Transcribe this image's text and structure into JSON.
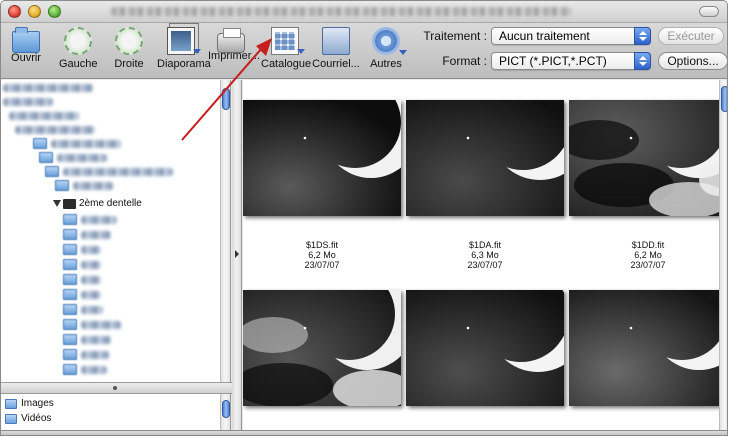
{
  "window": {
    "title": ""
  },
  "toolbar": {
    "tools": [
      {
        "id": "open",
        "label": "Ouvrir",
        "icon": "folder-icon"
      },
      {
        "id": "left",
        "label": "Gauche",
        "icon": "rotate-left-icon"
      },
      {
        "id": "right",
        "label": "Droite",
        "icon": "rotate-right-icon"
      },
      {
        "id": "slideshow",
        "label": "Diaporama",
        "icon": "slideshow-icon"
      },
      {
        "id": "print",
        "label": "Imprimer...",
        "icon": "printer-icon"
      },
      {
        "id": "catalog",
        "label": "Catalogue",
        "icon": "catalog-icon"
      },
      {
        "id": "mail",
        "label": "Courriel...",
        "icon": "mail-icon"
      },
      {
        "id": "more",
        "label": "Autres",
        "icon": "gear-icon"
      }
    ],
    "treatment": {
      "label": "Traitement :",
      "value": "Aucun traitement"
    },
    "format": {
      "label": "Format :",
      "value": "PICT (*.PICT,*.PCT)"
    },
    "execute_label": "Exécuter",
    "options_label": "Options..."
  },
  "tree": {
    "selected_folder": "2ème dentelle"
  },
  "places": [
    {
      "label": "Images",
      "icon": "folder-icon"
    },
    {
      "label": "Vidéos",
      "icon": "folder-icon"
    }
  ],
  "thumbnails": [
    {
      "name": "$1DS.fit",
      "size": "6,2 Mo",
      "date": "23/07/07"
    },
    {
      "name": "$1DA.fit",
      "size": "6,3 Mo",
      "date": "23/07/07"
    },
    {
      "name": "$1DD.fit",
      "size": "6,2 Mo",
      "date": "23/07/07"
    },
    {
      "name": "",
      "size": "",
      "date": ""
    },
    {
      "name": "",
      "size": "",
      "date": ""
    },
    {
      "name": "",
      "size": "",
      "date": ""
    }
  ],
  "colors": {
    "accent": "#3a6fd1",
    "annotation_arrow": "#c41e1e"
  }
}
